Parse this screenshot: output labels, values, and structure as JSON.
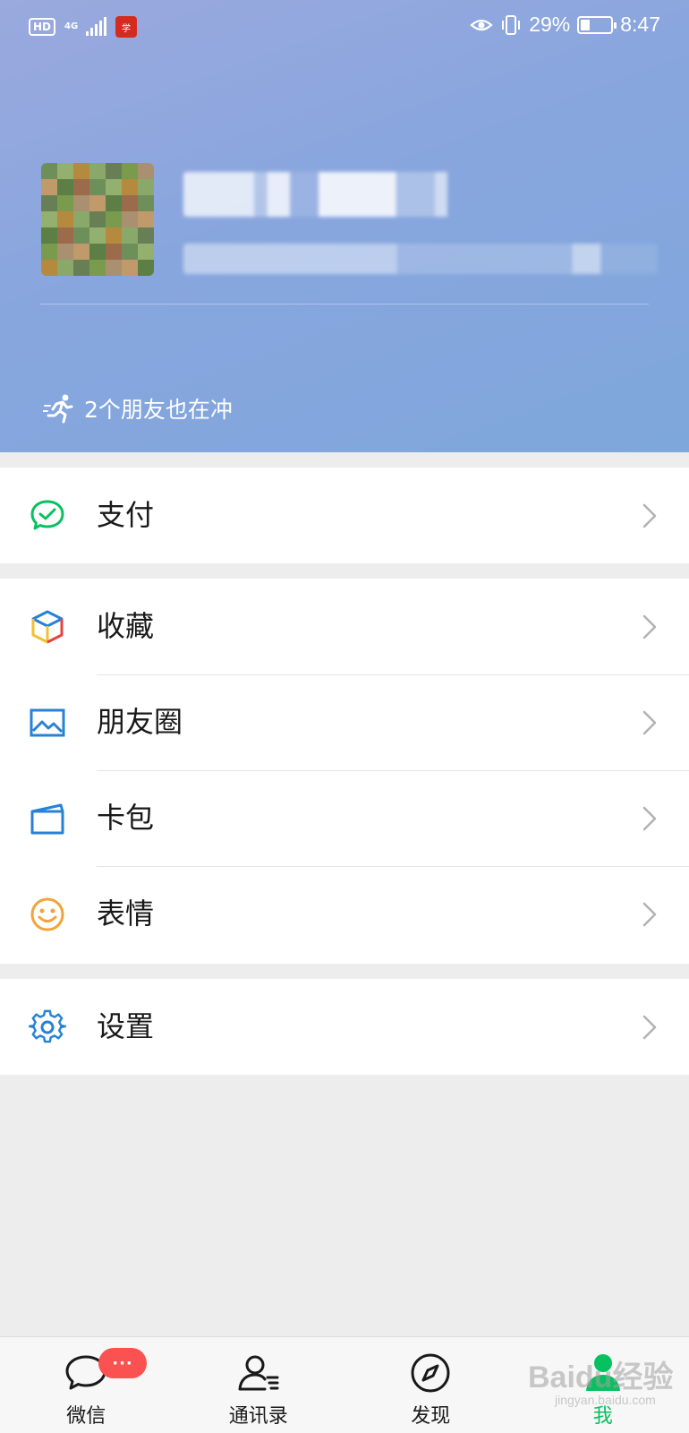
{
  "status_bar": {
    "hd": "HD",
    "network": "4G",
    "battery_percent": "29%",
    "battery_level": 0.29,
    "time": "8:47",
    "icons": [
      "signal-icon",
      "eye-icon",
      "vibrate-icon",
      "battery-icon"
    ]
  },
  "profile": {
    "friends_running_text": "2个朋友也在冲"
  },
  "menu": {
    "pay": {
      "label": "支付",
      "icon": "wechat-pay-icon",
      "color": "#07c160"
    },
    "favorites": {
      "label": "收藏",
      "icon": "favorites-cube-icon"
    },
    "moments": {
      "label": "朋友圈",
      "icon": "moments-picture-icon",
      "color": "#2782d7"
    },
    "cards": {
      "label": "卡包",
      "icon": "card-wallet-icon",
      "color": "#2782d7"
    },
    "stickers": {
      "label": "表情",
      "icon": "smiley-icon",
      "color": "#f2a33a"
    },
    "settings": {
      "label": "设置",
      "icon": "gear-icon",
      "color": "#2782d7"
    }
  },
  "tabbar": {
    "chats": {
      "label": "微信",
      "badge": "···"
    },
    "contacts": {
      "label": "通讯录"
    },
    "discover": {
      "label": "发现"
    },
    "me": {
      "label": "我",
      "active": true,
      "color": "#07c160"
    }
  },
  "watermark": {
    "brand": "Baidu经验",
    "url": "jingyan.baidu.com"
  }
}
